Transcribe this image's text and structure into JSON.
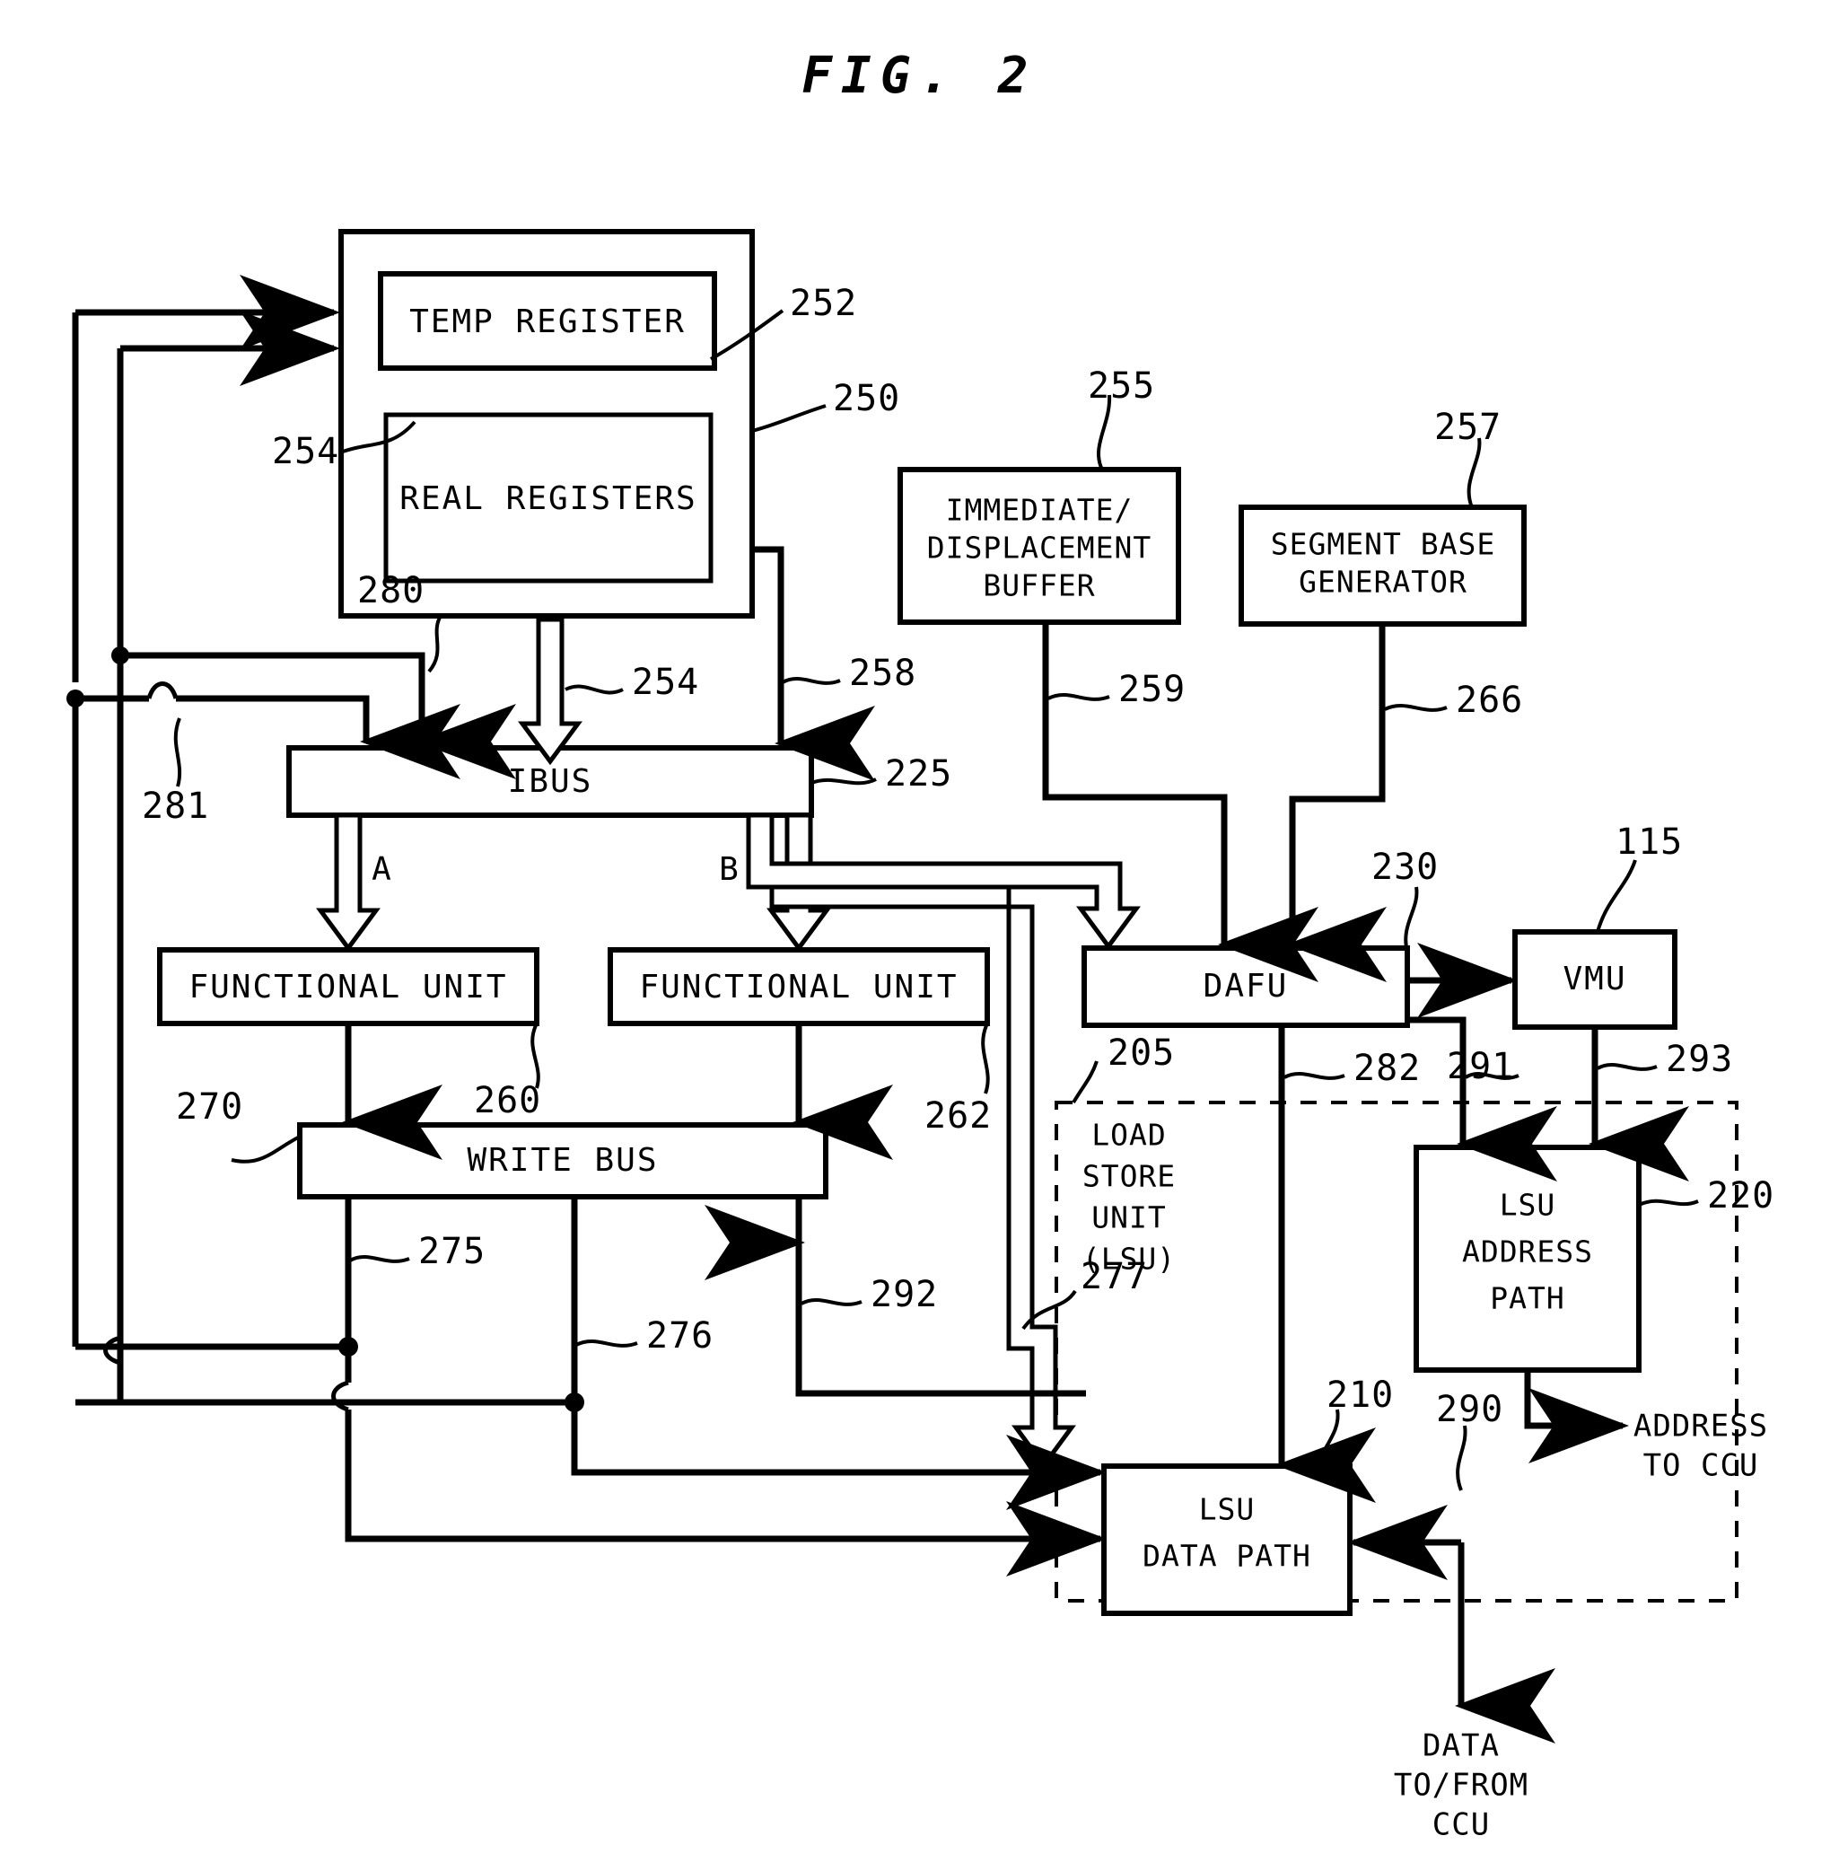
{
  "figure": {
    "title": "FIG. 2",
    "type": "patent-block-diagram"
  },
  "blocks": {
    "register_file": {
      "ref": "250",
      "label": ""
    },
    "temp_register": {
      "label": "TEMP REGISTER",
      "ref": "252"
    },
    "real_registers": {
      "label": "REAL REGISTERS",
      "ref": "254"
    },
    "imm_disp_buffer": {
      "line1": "IMMEDIATE/",
      "line2": "DISPLACEMENT",
      "line3": "BUFFER",
      "ref": "255"
    },
    "segment_base_generator": {
      "line1": "SEGMENT BASE",
      "line2": "GENERATOR",
      "ref": "257"
    },
    "ibus": {
      "label": "IBUS",
      "ref": "225"
    },
    "functional_unit_a": {
      "label": "FUNCTIONAL UNIT",
      "ref": "260"
    },
    "functional_unit_b": {
      "label": "FUNCTIONAL UNIT",
      "ref": "262"
    },
    "dafu": {
      "label": "DAFU",
      "ref": "230"
    },
    "vmu": {
      "label": "VMU",
      "ref": "115"
    },
    "write_bus": {
      "label": "WRITE BUS",
      "ref": "270"
    },
    "lsu_address_path": {
      "line1": "LSU",
      "line2": "ADDRESS",
      "line3": "PATH",
      "ref": "220"
    },
    "lsu_data_path": {
      "line1": "LSU",
      "line2": "DATA PATH",
      "ref": "210"
    },
    "load_store_unit": {
      "line1": "LOAD",
      "line2": "STORE",
      "line3": "UNIT",
      "line4": "(LSU)",
      "ref": "205"
    }
  },
  "ports": {
    "a": "A",
    "b": "B"
  },
  "external": {
    "address_to_ccu": {
      "line1": "ADDRESS",
      "line2": "TO CCU"
    },
    "data_to_from_ccu": {
      "line1": "DATA",
      "line2": "TO/FROM",
      "line3": "CCU"
    }
  },
  "reference_numerals": {
    "n115": "115",
    "n205": "205",
    "n210": "210",
    "n220": "220",
    "n225": "225",
    "n230": "230",
    "n250": "250",
    "n252": "252",
    "n254_left": "254",
    "n254_bus": "254",
    "n255": "255",
    "n257": "257",
    "n258": "258",
    "n259": "259",
    "n260": "260",
    "n262": "262",
    "n266": "266",
    "n270": "270",
    "n275": "275",
    "n276": "276",
    "n277": "277",
    "n280": "280",
    "n281": "281",
    "n282": "282",
    "n290": "290",
    "n291": "291",
    "n292": "292",
    "n293": "293"
  },
  "colors": {
    "ink": "#000000",
    "paper": "#ffffff"
  }
}
